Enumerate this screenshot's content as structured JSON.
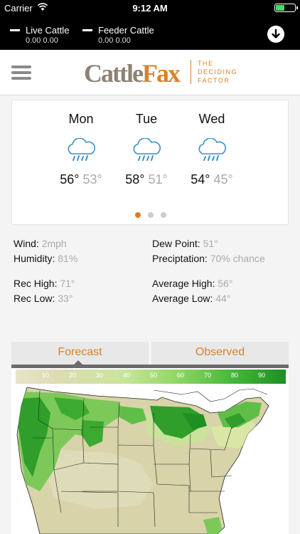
{
  "status_bar": {
    "carrier": "Carrier",
    "time": "9:12 AM"
  },
  "ticker": {
    "items": [
      {
        "name": "Live Cattle",
        "values": "0.00   0.00"
      },
      {
        "name": "Feeder Cattle",
        "values": "0.00   0.00"
      }
    ]
  },
  "header": {
    "brand_part1": "Cattle",
    "brand_part2": "Fax",
    "tagline_lines": [
      "THE",
      "DECIDING",
      "FACTOR"
    ]
  },
  "forecast": {
    "days": [
      {
        "name": "Mon",
        "high": "56°",
        "low": "53°",
        "icon": "rain-cloud-icon"
      },
      {
        "name": "Tue",
        "high": "58°",
        "low": "51°",
        "icon": "rain-cloud-icon"
      },
      {
        "name": "Wed",
        "high": "54°",
        "low": "45°",
        "icon": "rain-cloud-icon"
      }
    ],
    "page_count": 3,
    "active_page": 1
  },
  "details": {
    "wind_label": "Wind:",
    "wind_value": "2mph",
    "dew_label": "Dew Point:",
    "dew_value": "51°",
    "humidity_label": "Humidity:",
    "humidity_value": "81%",
    "precip_label": "Preciptation:",
    "precip_value": "70% chance",
    "rec_high_label": "Rec High:",
    "rec_high_value": "71°",
    "avg_high_label": "Average High:",
    "avg_high_value": "56°",
    "rec_low_label": "Rec Low:",
    "rec_low_value": "33°",
    "avg_low_label": "Average Low:",
    "avg_low_value": "44°"
  },
  "tabs": [
    {
      "label": "Forecast",
      "active": true
    },
    {
      "label": "Observed",
      "active": false
    }
  ],
  "map": {
    "scale_ticks": [
      "10",
      "20",
      "30",
      "40",
      "50",
      "60",
      "70",
      "80",
      "90"
    ]
  },
  "colors": {
    "accent": "#d9822b",
    "brand_gray": "#8c8474",
    "map_green": "#2f9e2a",
    "map_tan": "#d8d3a8"
  }
}
